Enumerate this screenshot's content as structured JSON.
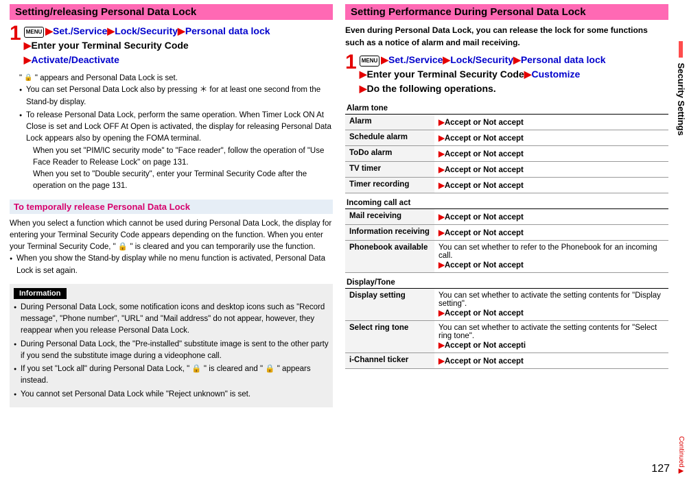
{
  "left": {
    "bar": "Setting/releasing Personal Data Lock",
    "step_num": "1",
    "menu_badge": "MENU",
    "nav_parts": {
      "a": "Set./Service",
      "b": "Lock/Security",
      "c": "Personal data lock",
      "d": "Enter your Terminal Security Code",
      "e": "Activate/Deactivate"
    },
    "notes_intro": "appears and Personal Data Lock is set.",
    "notes": [
      "You can set Personal Data Lock also by pressing ＊ for at least one second from the Stand-by display.",
      "To release Personal Data Lock, perform the same operation. When Timer Lock ON At Close is set and Lock OFF At Open is activated, the display for releasing Personal Data Lock appears also by opening the FOMA terminal.",
      "When you set \"PIM/IC security mode\" to \"Face reader\", follow the operation of \"Use Face Reader to Release Lock\" on page 131.",
      "When you set to \"Double security\", enter your Terminal Security Code after the operation on the page 131."
    ],
    "sub_heading": "To temporally release Personal Data Lock",
    "para1": "When you select a function which cannot be used during Personal Data Lock, the display for entering your Terminal Security Code appears depending on the function. When you enter your Terminal Security Code, \" 🔒 \" is cleared and you can temporarily use the function.",
    "para2": "When you show the Stand-by display while no menu function is activated, Personal Data Lock is set again.",
    "info_tag": "Information",
    "info_items": [
      "During Personal Data Lock, some notification icons and desktop icons such as \"Record message\", \"Phone number\", \"URL\" and \"Mail address\" do not appear, however, they reappear when you release Personal Data Lock.",
      "During Personal Data Lock, the \"Pre-installed\" substitute image is sent to the other party if you send the substitute image during a videophone call.",
      "If you set \"Lock all\" during Personal Data Lock, \" 🔒 \" is cleared and \" 🔒 \" appears instead.",
      "You cannot set Personal Data Lock while \"Reject unknown\" is set."
    ]
  },
  "right": {
    "bar": "Setting Performance During Personal Data Lock",
    "intro": "Even during Personal Data Lock, you can release the lock for some functions such as a notice of alarm and mail receiving.",
    "step_num": "1",
    "menu_badge": "MENU",
    "nav_parts": {
      "a": "Set./Service",
      "b": "Lock/Security",
      "c": "Personal data lock",
      "d": "Enter your Terminal Security Code",
      "e": "Customize",
      "f": "Do the following operations."
    },
    "sections": [
      {
        "label": "Alarm tone",
        "rows": [
          {
            "k": "Alarm",
            "v": "Accept or Not accept"
          },
          {
            "k": "Schedule alarm",
            "v": "Accept or Not accept"
          },
          {
            "k": "ToDo alarm",
            "v": "Accept or Not accept"
          },
          {
            "k": "TV timer",
            "v": "Accept or Not accept"
          },
          {
            "k": "Timer recording",
            "v": "Accept or Not accept"
          }
        ]
      },
      {
        "label": "Incoming call act",
        "rows": [
          {
            "k": "Mail receiving",
            "v": "Accept or Not accept"
          },
          {
            "k": "Information receiving",
            "v": "Accept or Not accept"
          },
          {
            "k": "Phonebook available",
            "desc": "You can set whether to refer to the Phonebook for an incoming call.",
            "v": "Accept or Not accept"
          }
        ]
      },
      {
        "label": "Display/Tone",
        "rows": [
          {
            "k": "Display setting",
            "desc": "You can set whether to activate the setting contents for \"Display setting\".",
            "v": "Accept or Not accept"
          },
          {
            "k": "Select ring tone",
            "desc": "You can set whether to activate the setting contents for \"Select ring tone\".",
            "v": "Accept or Not accepti"
          },
          {
            "k": "i-Channel ticker",
            "v": "Accept or Not accept"
          }
        ]
      }
    ]
  },
  "side_tab": "Security Settings",
  "page_num": "127",
  "continued": "Continued"
}
